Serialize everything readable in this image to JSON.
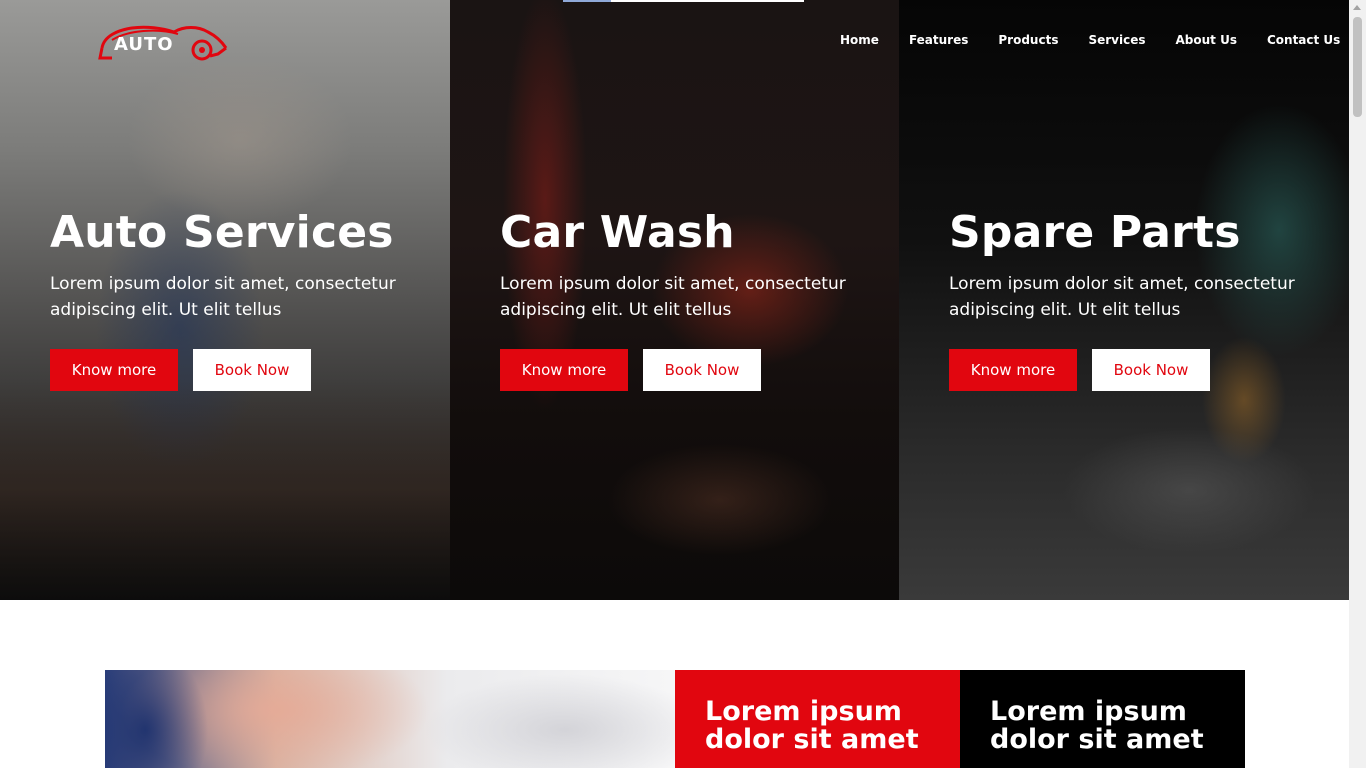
{
  "header": {
    "logo_text": "AUTO",
    "nav": [
      "Home",
      "Features",
      "Products",
      "Services",
      "About Us",
      "Contact Us"
    ]
  },
  "hero": {
    "panels": [
      {
        "title": "Auto Services",
        "description": "Lorem ipsum dolor sit amet, consectetur adipiscing elit. Ut elit tellus",
        "primary_button": "Know more",
        "secondary_button": "Book Now"
      },
      {
        "title": "Car Wash",
        "description": "Lorem ipsum dolor sit amet, consectetur adipiscing elit. Ut elit tellus",
        "primary_button": "Know more",
        "secondary_button": "Book Now"
      },
      {
        "title": "Spare Parts",
        "description": "Lorem ipsum dolor sit amet, consectetur adipiscing elit. Ut elit tellus",
        "primary_button": "Know more",
        "secondary_button": "Book Now"
      }
    ]
  },
  "features": {
    "boxes": [
      {
        "title": "Lorem ipsum dolor sit amet"
      },
      {
        "title": "Lorem ipsum dolor sit amet"
      }
    ]
  },
  "colors": {
    "accent": "#e1060f",
    "dark": "#000000",
    "light": "#ffffff"
  },
  "icons": {
    "logo": "car-logo-icon"
  }
}
